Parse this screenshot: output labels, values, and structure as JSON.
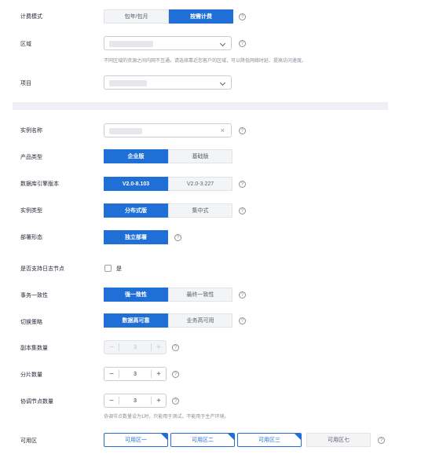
{
  "billing": {
    "label": "计费模式",
    "options": [
      "包年/包月",
      "按需计费"
    ]
  },
  "region": {
    "label": "区域",
    "hint": "不同区域的资源之间内网不互通。请选择靠近您客户的区域，可以降低网络时延、提高访问速度。"
  },
  "project": {
    "label": "项目"
  },
  "instance_name": {
    "label": "实例名称"
  },
  "product_type": {
    "label": "产品类型",
    "options": [
      "企业版",
      "基础版"
    ]
  },
  "engine_version": {
    "label": "数据库引擎版本",
    "options": [
      "V2.0-8.103",
      "V2.0-3.227"
    ]
  },
  "instance_type": {
    "label": "实例类型",
    "options": [
      "分布式版",
      "集中式"
    ]
  },
  "deploy_form": {
    "label": "部署形态",
    "options": [
      "独立部署"
    ]
  },
  "log_node": {
    "label": "是否支持日志节点",
    "checkbox_label": "是"
  },
  "consistency": {
    "label": "事务一致性",
    "options": [
      "强一致性",
      "最终一致性"
    ]
  },
  "switch_policy": {
    "label": "切换策略",
    "options": [
      "数据高可靠",
      "业务高可用"
    ]
  },
  "replica_count": {
    "label": "副本集数量",
    "value": "3"
  },
  "shard_count": {
    "label": "分片数量",
    "value": "3"
  },
  "coordinator_count": {
    "label": "协调节点数量",
    "value": "3",
    "hint": "协调节点数量设为1时，只能用于测试，不能用于生产环境。"
  },
  "az": {
    "label": "可用区",
    "options": [
      "可用区一",
      "可用区二",
      "可用区三",
      "可用区七"
    ]
  },
  "icons": {
    "help": "?",
    "clear": "×",
    "minus": "−",
    "plus": "+"
  },
  "colors": {
    "accent": "#1f6fd6",
    "band": "#eef0f5"
  }
}
